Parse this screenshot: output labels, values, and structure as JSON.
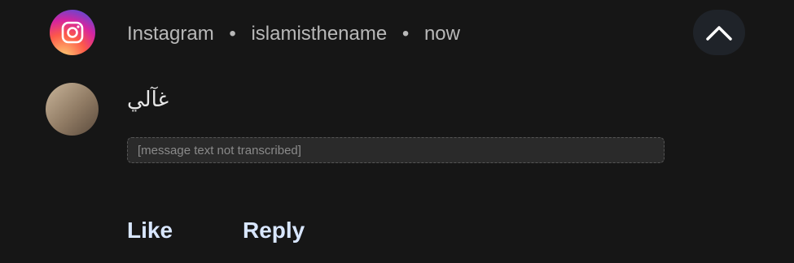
{
  "notification": {
    "app_name": "Instagram",
    "separator": "•",
    "account": "islamisthename",
    "time": "now",
    "sender_name": "غآلي",
    "message_text": "",
    "message_note": "[message text not transcribed]"
  },
  "actions": {
    "like_label": "Like",
    "reply_label": "Reply"
  },
  "icons": {
    "app": "instagram-icon",
    "collapse": "chevron-up-icon"
  },
  "colors": {
    "background": "#161616",
    "action_text": "#d8e6ff",
    "meta_text": "#b8b8b8"
  }
}
